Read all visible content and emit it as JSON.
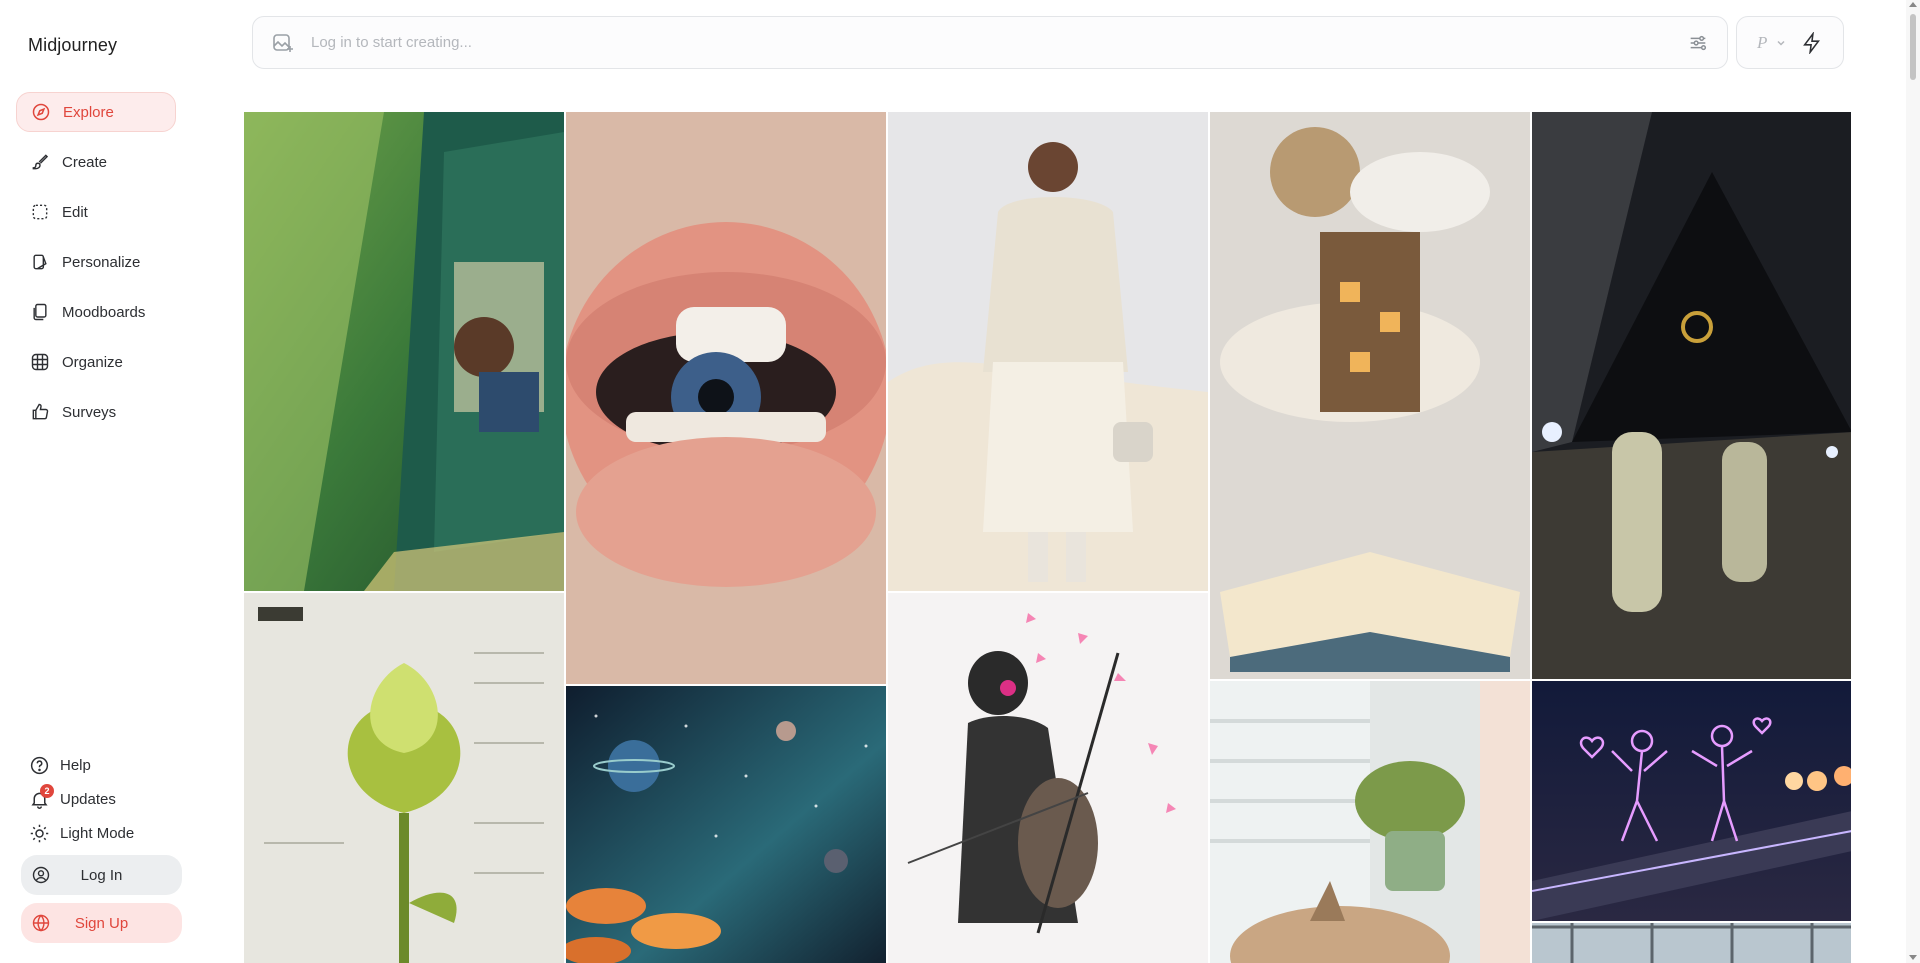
{
  "app": {
    "name": "Midjourney"
  },
  "nav": [
    {
      "label": "Explore",
      "icon": "compass-icon",
      "active": true
    },
    {
      "label": "Create",
      "icon": "brush-icon"
    },
    {
      "label": "Edit",
      "icon": "edit-icon"
    },
    {
      "label": "Personalize",
      "icon": "personalize-icon"
    },
    {
      "label": "Moodboards",
      "icon": "moodboards-icon"
    },
    {
      "label": "Organize",
      "icon": "grid-icon"
    },
    {
      "label": "Surveys",
      "icon": "thumbs-up-icon"
    }
  ],
  "bottom": {
    "help": "Help",
    "updates": "Updates",
    "updates_badge": "2",
    "light_mode": "Light Mode",
    "login": "Log In",
    "signup": "Sign Up"
  },
  "prompt": {
    "placeholder": "Log in to start creating...",
    "mode_letter": "P"
  },
  "gallery": [
    {
      "subject": "anime girl leaning out of green train window"
    },
    {
      "subject": "glossy lips with eye inside mouth"
    },
    {
      "subject": "woman in cream sweater and ruffled skirt"
    },
    {
      "subject": "book with floating castle and hot air balloon"
    },
    {
      "subject": "astronauts walking toward dark pyramid"
    },
    {
      "subject": "glass flower botanical blueprint"
    },
    {
      "subject": "cosmic sky with planets over glowing mushrooms"
    },
    {
      "subject": "woman playing cello with pink shards"
    },
    {
      "subject": "cat beside potted plant near window"
    },
    {
      "subject": "neon couple line art on rail track"
    },
    {
      "subject": "window with city view"
    }
  ],
  "colors": {
    "accent": "#e0463c",
    "accent_bg": "#fdecec"
  }
}
